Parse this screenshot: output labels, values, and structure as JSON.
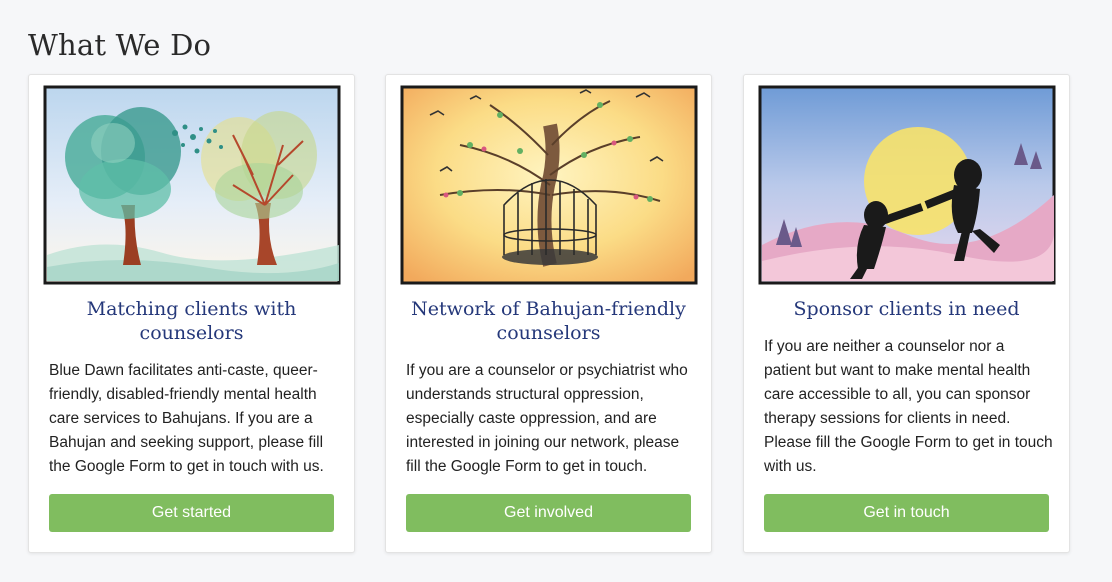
{
  "section": {
    "title": "What We Do"
  },
  "cards": [
    {
      "heading": "Matching clients with counselors",
      "body": "Blue Dawn facilitates anti-caste, queer-friendly, disabled-friendly mental health care services to Bahujans. If you are a Bahujan and seeking support, please fill the Google Form to get in touch with us.",
      "button": "Get started"
    },
    {
      "heading": "Network of Bahujan-friendly counselors",
      "body": "If you are a counselor or psychiatrist who understands structural oppression, especially caste oppression, and are interested in joining our network, please fill the Google Form to get in touch.",
      "button": "Get involved"
    },
    {
      "heading": "Sponsor clients in need",
      "body": "If you are neither a counselor nor a patient but want to make mental health care accessible to all, you can sponsor therapy sessions for clients in need. Please fill the Google Form to get in touch with us.",
      "button": "Get in touch"
    }
  ],
  "colors": {
    "heading": "#25387a",
    "button": "#80bd5f",
    "background": "#f6f7f9"
  }
}
